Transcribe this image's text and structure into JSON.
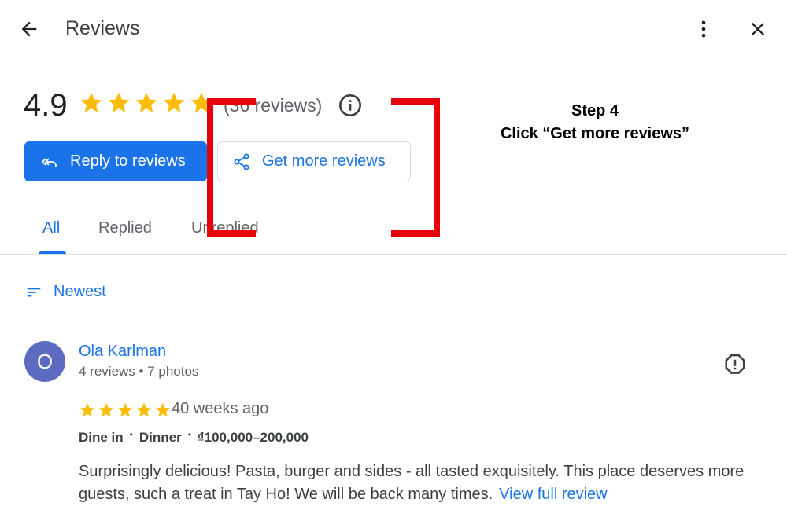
{
  "header": {
    "title": "Reviews",
    "back_icon": "arrow-back-icon",
    "more_icon": "more-vert-icon",
    "close_icon": "close-icon"
  },
  "summary": {
    "rating": "4.9",
    "stars_filled": 5,
    "review_count": "(36 reviews)",
    "info_icon": "info-icon"
  },
  "actions": {
    "reply_label": "Reply to reviews",
    "get_more_label": "Get more reviews"
  },
  "tabs": [
    {
      "label": "All",
      "active": true
    },
    {
      "label": "Replied",
      "active": false
    },
    {
      "label": "Unreplied",
      "active": false
    }
  ],
  "sort": {
    "label": "Newest"
  },
  "review": {
    "avatar_letter": "O",
    "avatar_color": "#5c6bc0",
    "name": "Ola Karlman",
    "meta": "4 reviews • 7 photos",
    "stars": 5,
    "time": "40 weeks ago",
    "tags": [
      "Dine in",
      "Dinner",
      "₫100,000–200,000"
    ],
    "text": "Surprisingly delicious! Pasta, burger and sides - all tasted exquisitely. This place deserves more guests, such a treat in Tay Ho! We will be back many times.",
    "view_full": "View full review"
  },
  "annotation": {
    "line1": "Step 4",
    "line2": "Click “Get more reviews”",
    "color": "#e8000b"
  },
  "colors": {
    "accent": "#1a73e8",
    "star": "#fbbc04"
  }
}
